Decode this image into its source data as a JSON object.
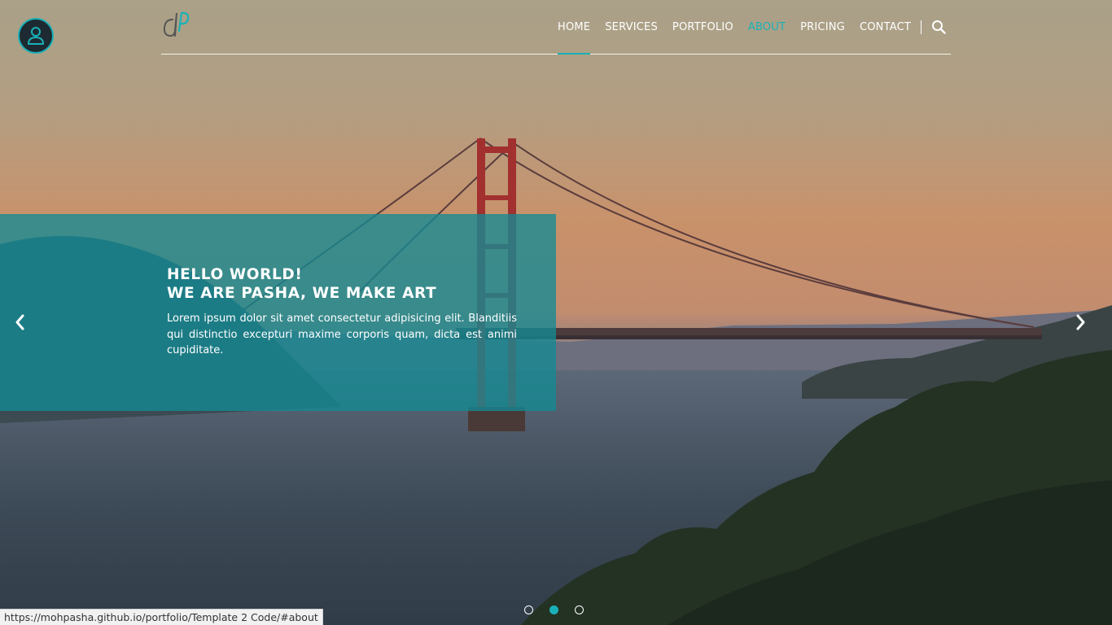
{
  "nav": {
    "items": [
      {
        "label": "HOME"
      },
      {
        "label": "SERVICES"
      },
      {
        "label": "PORTFOLIO"
      },
      {
        "label": "ABOUT"
      },
      {
        "label": "PRICING"
      },
      {
        "label": "CONTACT"
      }
    ],
    "current": "ABOUT",
    "underlined": "HOME"
  },
  "logo": {
    "letters": "dP"
  },
  "hero": {
    "title_line1": "HELLO WORLD!",
    "title_line2": "WE ARE PASHA, WE MAKE ART",
    "body": "Lorem ipsum dolor sit amet consectetur adipisicing elit. Blanditiis qui distinctio excepturi maxime corporis quam, dicta est animi cupiditate."
  },
  "carousel": {
    "slides_count": 3,
    "active_index": 1
  },
  "status_bar": {
    "url": "https://mohpasha.github.io/portfolio/Template 2 Code/#about"
  },
  "icons": {
    "user": "user-icon",
    "search": "search-icon",
    "prev": "chevron-left-icon",
    "next": "chevron-right-icon"
  },
  "colors": {
    "accent": "#19b1b7",
    "panel": "#138b94",
    "text": "#ffffff"
  }
}
